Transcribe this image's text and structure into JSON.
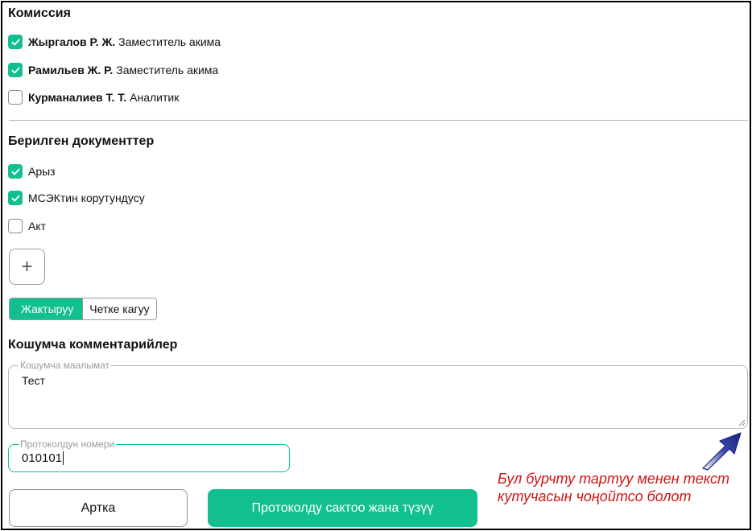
{
  "commission": {
    "title": "Комиссия",
    "members": [
      {
        "name": "Жыргалов Р. Ж.",
        "role": "Заместитель акима",
        "checked": true
      },
      {
        "name": "Рамильев Ж. Р.",
        "role": "Заместитель акима",
        "checked": true
      },
      {
        "name": "Курманалиев Т. Т.",
        "role": "Аналитик",
        "checked": false
      }
    ]
  },
  "documents": {
    "title": "Берилген документтер",
    "items": [
      {
        "label": "Арыз",
        "checked": true
      },
      {
        "label": "МСЭКтин корутундусу",
        "checked": true
      },
      {
        "label": "Акт",
        "checked": false
      }
    ],
    "add_symbol": "+"
  },
  "decision": {
    "approve_label": "Жактыруу",
    "reject_label": "Четке кагуу",
    "selected": "approve"
  },
  "comments": {
    "title": "Кошумча комментарийлер",
    "field_label": "Кошумча маалымат",
    "field_value": "Тест"
  },
  "protocol": {
    "field_label": "Протоколдун номери",
    "field_value": "010101"
  },
  "actions": {
    "back_label": "Артка",
    "save_label": "Протоколду сактоо жана түзүү"
  },
  "annotation": {
    "text": "Бул бурчту тартуу менен текст кутучасын чоңойтсо болот",
    "text_color": "#d21414",
    "arrow_color": "#1a237e"
  },
  "colors": {
    "accent": "#12c08f",
    "border": "#b9b9b9",
    "text": "#111111"
  }
}
